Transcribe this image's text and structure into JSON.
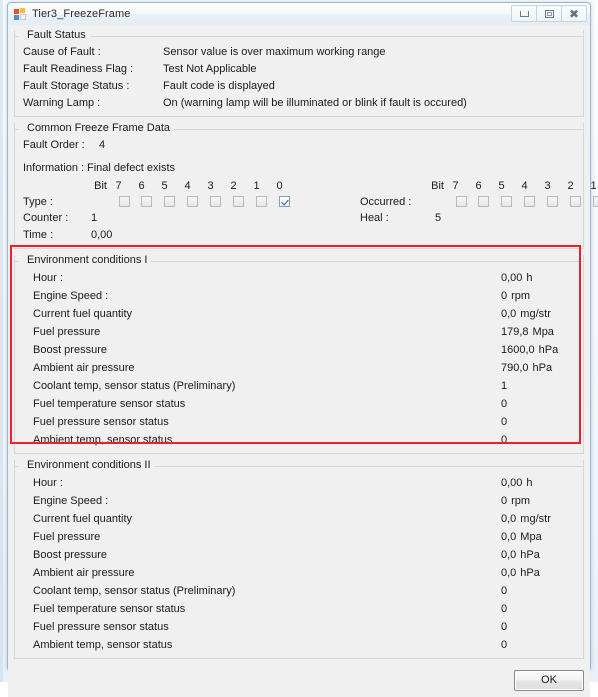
{
  "window": {
    "title": "Tier3_FreezeFrame",
    "icon": "app-icon",
    "buttons": {
      "minimize": "minimize-icon",
      "maximize": "maximize-icon",
      "close": "close-icon"
    }
  },
  "fault_status": {
    "group_title": "Fault Status",
    "rows": [
      {
        "label": "Cause of Fault :",
        "value": "Sensor value is over maximum working range"
      },
      {
        "label": "Fault Readiness Flag :",
        "value": "Test Not Applicable"
      },
      {
        "label": "Fault Storage Status :",
        "value": "Fault code is displayed"
      },
      {
        "label": "Warning Lamp :",
        "value": "On (warning lamp will be illuminated or blink if fault is occured)"
      }
    ]
  },
  "common_freeze_frame": {
    "group_title": "Common Freeze Frame Data",
    "fault_order_label": "Fault Order :",
    "fault_order_value": "4",
    "information_label": "Information :",
    "information_value": "Final defect exists",
    "bit_word": "Bit",
    "bit_numbers": [
      "7",
      "6",
      "5",
      "4",
      "3",
      "2",
      "1",
      "0"
    ],
    "type_label": "Type :",
    "type_bits": [
      false,
      false,
      false,
      false,
      false,
      false,
      false,
      true
    ],
    "occurred_label": "Occurred :",
    "occurred_bits": [
      false,
      false,
      false,
      false,
      false,
      false,
      false,
      true
    ],
    "counter_label": "Counter :",
    "counter_value": "1",
    "heal_label": "Heal :",
    "heal_value": "5",
    "time_label": "Time :",
    "time_value": "0,00"
  },
  "environment_I": {
    "group_title": "Environment conditions I",
    "highlighted": true,
    "highlight_color": "#e8222a",
    "rows": [
      {
        "label": "Hour :",
        "value": "0,00",
        "unit": "h"
      },
      {
        "label": "Engine Speed :",
        "value": "0",
        "unit": "rpm"
      },
      {
        "label": "Current fuel quantity",
        "value": "0,0",
        "unit": "mg/str"
      },
      {
        "label": "Fuel pressure",
        "value": "179,8",
        "unit": "Mpa"
      },
      {
        "label": "Boost pressure",
        "value": "1600,0",
        "unit": "hPa"
      },
      {
        "label": "Ambient air pressure",
        "value": "790,0",
        "unit": "hPa"
      },
      {
        "label": "Coolant temp, sensor status (Preliminary)",
        "value": "1",
        "unit": ""
      },
      {
        "label": "Fuel temperature sensor status",
        "value": "0",
        "unit": ""
      },
      {
        "label": "Fuel pressure sensor status",
        "value": "0",
        "unit": ""
      },
      {
        "label": "Ambient temp, sensor status",
        "value": "0",
        "unit": ""
      }
    ]
  },
  "environment_II": {
    "group_title": "Environment conditions II",
    "highlighted": false,
    "rows": [
      {
        "label": "Hour :",
        "value": "0,00",
        "unit": "h"
      },
      {
        "label": "Engine Speed :",
        "value": "0",
        "unit": "rpm"
      },
      {
        "label": "Current fuel quantity",
        "value": "0,0",
        "unit": "mg/str"
      },
      {
        "label": "Fuel pressure",
        "value": "0,0",
        "unit": "Mpa"
      },
      {
        "label": "Boost pressure",
        "value": "0,0",
        "unit": "hPa"
      },
      {
        "label": "Ambient air pressure",
        "value": "0,0",
        "unit": "hPa"
      },
      {
        "label": "Coolant temp, sensor status (Preliminary)",
        "value": "0",
        "unit": ""
      },
      {
        "label": "Fuel temperature sensor status",
        "value": "0",
        "unit": ""
      },
      {
        "label": "Fuel pressure sensor status",
        "value": "0",
        "unit": ""
      },
      {
        "label": "Ambient temp, sensor status",
        "value": "0",
        "unit": ""
      }
    ]
  },
  "footer": {
    "ok_label": "OK"
  }
}
